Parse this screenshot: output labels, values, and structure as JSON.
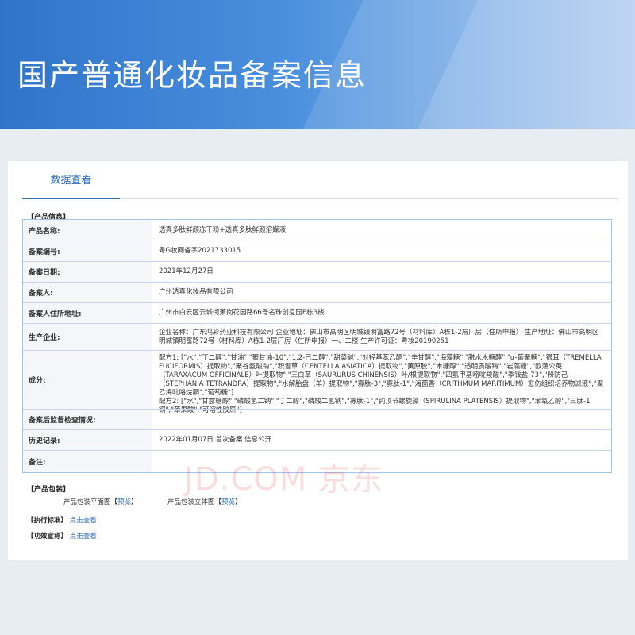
{
  "banner": {
    "title": "国产普通化妆品备案信息"
  },
  "tabs": [
    {
      "label": "数据查看"
    }
  ],
  "product_info": {
    "section_title": "【产品信息】",
    "rows": [
      {
        "label": "产品名称:",
        "value": "透真多肽鲜颜冻干粉+透真多肽鲜颜溶媒液"
      },
      {
        "label": "备案编号:",
        "value": "粤G妆网备字2021733015"
      },
      {
        "label": "备案日期:",
        "value": "2021年12月27日"
      },
      {
        "label": "备案人:",
        "value": "广州透真化妆品有限公司"
      },
      {
        "label": "备案人住所地址:",
        "value": "广州市白云区云城街萧岗花园路66号名珠创意园E栋3楼"
      },
      {
        "label": "生产企业:",
        "value": "企业名称：广东鸿彩药业科技有限公司 企业地址：佛山市高明区明城镇明富路72号（材料库）A栋1-2层厂房（住所申报） 生产地址：佛山市高明区明城镇明富路72号（材料库）A栋1-2层厂房（住所申报）一、二楼 生产许可证：粤妆20190251"
      },
      {
        "label": "成分:",
        "lines": [
          "配方1: [\"水\",\"丁二醇\",\"甘油\",\"聚甘油-10\",\"1,2-己二醇\",\"甜菜碱\",\"对羟基苯乙酮\",\"辛甘醇\",\"海藻糖\",\"脱水木糖醇\",\"α-葡聚糖\",\"银耳（TREMELLA FUCIFORMIS）提取物\",\"聚谷氨酸钠\",\"积雪草（CENTELLA ASIATICA）提取物\",\"黄原胶\",\"木糖醇\",\"透明质酸钠\",\"岩藻糖\",\"欧蒲公英（TARAXACUM OFFICINALE）叶提取物\",\"三白草（SAURURUS CHINENSIS）叶/根提取物\",\"四氢甲基嘧啶羧酸\",\"季铵盐-73\",\"粉防己（STEPHANIA TETRANDRA）提取物\",\"水解胎盘（羊）提取物\",\"寡肽-3\",\"寡肽-1\",\"海茴香（CRITHMUM MARITIMUM）愈伤组织培养物滤液\",\"聚乙烯吡咯烷酮\",\"葡萄糖\"]",
          "配方2: [\"水\",\"甘露糖醇\",\"磷酸氢二钠\",\"丁二醇\",\"磷酸二氢钠\",\"寡肽-1\",\"钝顶节螺旋藻（SPIRULINA PLATENSIS）提取物\",\"苯氧乙醇\",\"三肽-1 铜\",\"苯果酸\",\"可溶性胶原\"]"
        ]
      },
      {
        "label": "备案后监督检查情况:",
        "value": ""
      },
      {
        "label": "历史记录:",
        "value": "2022年01月07日 首次备案 信息公开"
      },
      {
        "label": "备注:",
        "value": ""
      }
    ]
  },
  "watermark": "JD.COM 京东",
  "packaging": {
    "section_title": "【产品包装】",
    "flat": {
      "label": "产品包装平面图",
      "bracket_open": "【",
      "link": "预览",
      "bracket_close": "】"
    },
    "solid": {
      "label": "产品包装立体图",
      "bracket_open": "【",
      "link": "预览",
      "bracket_close": "】"
    }
  },
  "standard": {
    "label": "【执行标准】",
    "link": "点击查看"
  },
  "claims": {
    "label": "【功效宣称】",
    "link": "点击查看"
  }
}
